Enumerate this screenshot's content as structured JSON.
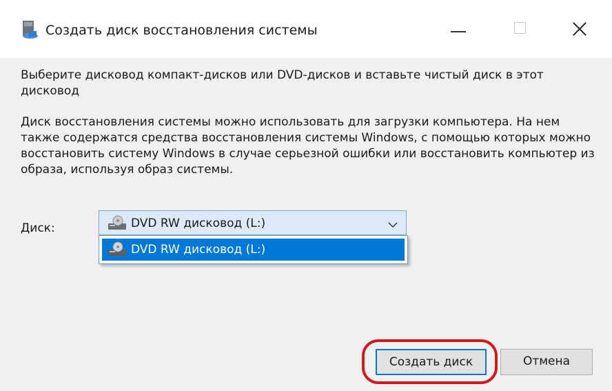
{
  "window": {
    "title": "Создать диск восстановления системы",
    "controls": [
      "minimize",
      "maximize",
      "close"
    ]
  },
  "content": {
    "instruction": "Выберите дисковод компакт-дисков или DVD-дисков и вставьте чистый диск в этот дисковод",
    "description": "Диск восстановления системы можно использовать для загрузки компьютера. На нем также содержатся средства восстановления системы Windows, с помощью которых можно восстановить систему Windows в случае серьезной ошибки или восстановить компьютер из образа, используя образ системы."
  },
  "disk_selector": {
    "label": "Диск:",
    "selected": "DVD RW дисковод (L:)",
    "options": [
      "DVD RW дисковод (L:)"
    ]
  },
  "buttons": {
    "create": "Создать диск",
    "cancel": "Отмена"
  },
  "colors": {
    "accent": "#0078d7",
    "highlight": "#cf1b1b",
    "client_bg": "#f0f0f0"
  },
  "icons": {
    "title": "recovery-disk-icon",
    "drive": "dvd-drive-icon",
    "dropdown": "chevron-down-icon"
  }
}
